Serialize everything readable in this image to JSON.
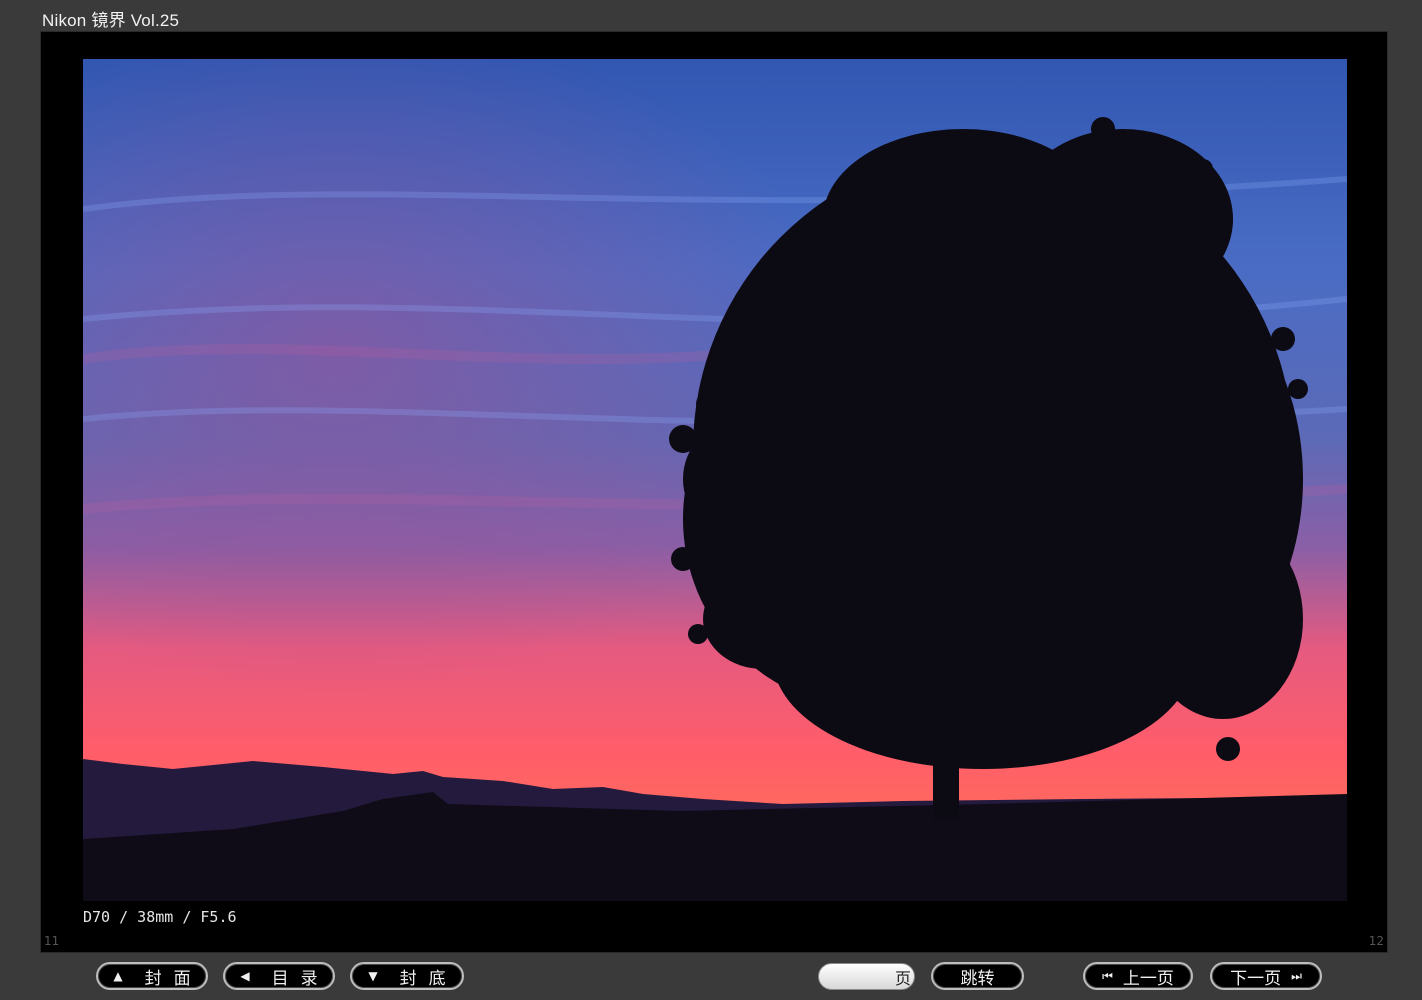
{
  "window": {
    "title": "Nikon 镜界 Vol.25"
  },
  "viewer": {
    "photo_caption": "D70 / 38mm / F5.6",
    "left_page_number": "11",
    "right_page_number": "12"
  },
  "toolbar": {
    "cover_label": "封面",
    "cover_icon": "triangle-up-icon",
    "toc_label": "目录",
    "toc_icon": "triangle-left-icon",
    "back_cover_label": "封底",
    "back_cover_icon": "triangle-down-icon",
    "page_input_value": "",
    "page_unit_label": "页",
    "go_label": "跳转",
    "prev_label": "上一页",
    "prev_icon": "skip-back-icon",
    "next_label": "下一页",
    "next_icon": "skip-forward-icon"
  },
  "colors": {
    "background": "#3a3a3a",
    "viewer_bg": "#000000",
    "sky_top": "#3f63b8",
    "sky_bottom": "#ff5a6a"
  }
}
